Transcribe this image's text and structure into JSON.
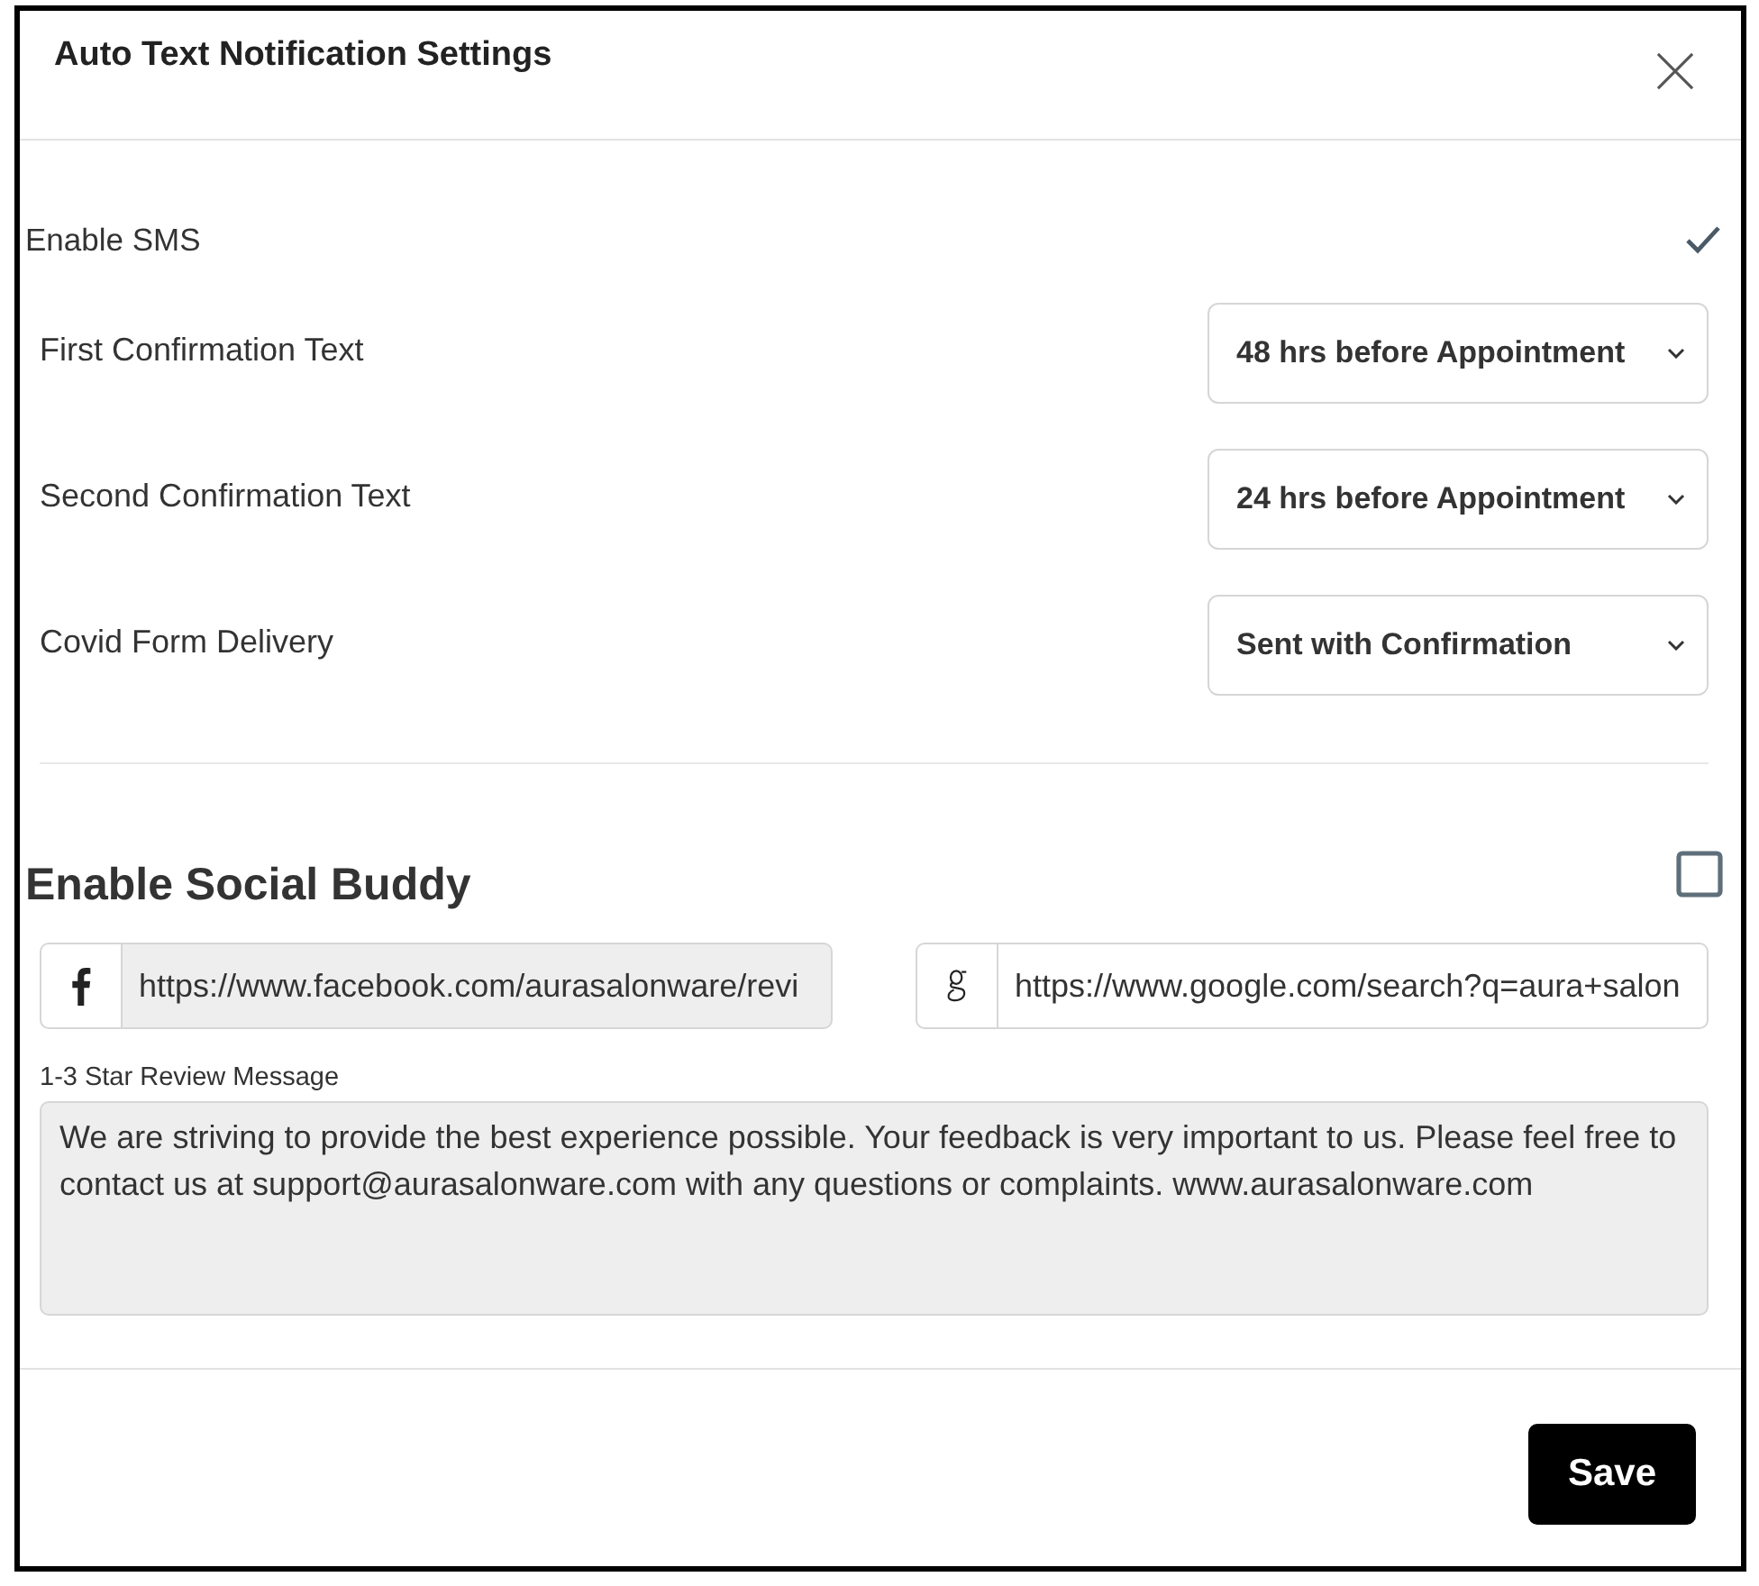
{
  "dialog": {
    "title": "Auto Text Notification Settings"
  },
  "sms": {
    "label": "Enable SMS",
    "checked": true
  },
  "settings": [
    {
      "label": "First Confirmation Text",
      "value": "48 hrs before Appointment"
    },
    {
      "label": "Second Confirmation Text",
      "value": "24 hrs before Appointment"
    },
    {
      "label": "Covid Form Delivery",
      "value": "Sent with Confirmation"
    }
  ],
  "social": {
    "label": "Enable Social Buddy",
    "checked": false,
    "links": [
      {
        "kind": "facebook",
        "value": "https://www.facebook.com/aurasalonware/revi",
        "disabled": true
      },
      {
        "kind": "google",
        "value": "https://www.google.com/search?q=aura+salon",
        "disabled": false
      }
    ]
  },
  "review": {
    "label": "1-3 Star Review Message",
    "value": "We are striving to provide the best experience possible. Your feedback is very important to us. Please feel free to contact us at support@aurasalonware.com with any questions or complaints. www.aurasalonware.com"
  },
  "buttons": [
    {
      "label": "Save"
    }
  ]
}
